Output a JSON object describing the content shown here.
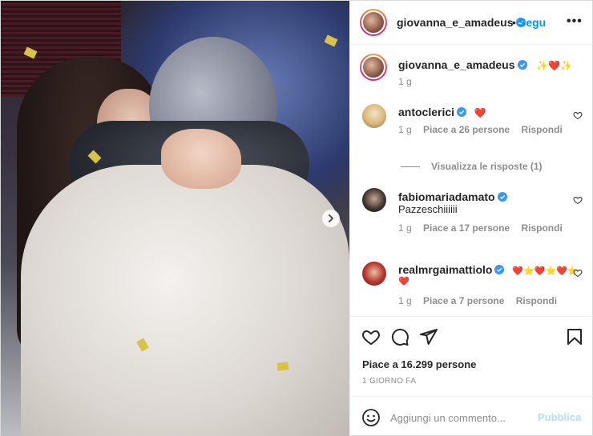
{
  "post": {
    "author": "giovanna_e_amadeus",
    "follow_label": "Segu",
    "more_label": "•••",
    "dot": "•"
  },
  "caption": {
    "username": "giovanna_e_amadeus",
    "text": "✨❤️✨",
    "time": "1 g"
  },
  "comments": [
    {
      "username": "antoclerici",
      "text": "❤️",
      "time": "1 g",
      "likes": "Piace a 26 persone",
      "reply": "Rispondi"
    },
    {
      "username": "fabiomariadamato",
      "text": "Pazzeschiiiiii",
      "time": "1 g",
      "likes": "Piace a 17 persone",
      "reply": "Rispondi"
    },
    {
      "username": "realmrgaimattiolo",
      "text": "❤️⭐❤️⭐❤️⭐",
      "text2": "❤️",
      "time": "1 g",
      "likes": "Piace a 7 persone",
      "reply": "Rispondi"
    }
  ],
  "view_replies": "Visualizza le risposte (1)",
  "footer": {
    "likes": "Piace a 16.299 persone",
    "ago": "1 GIORNO FA",
    "comment_placeholder": "Aggiungi un commento...",
    "publish_label": "Pubblica"
  },
  "colors": {
    "link": "#0095f6",
    "publish_disabled": "#b2dffc",
    "verified": "#3897f0",
    "muted": "#8e8e8e"
  },
  "icons": {
    "like": "heart-icon",
    "comment": "comment-icon",
    "share": "share-icon",
    "save": "bookmark-icon",
    "next": "chevron-right-icon",
    "emoji": "emoji-icon"
  }
}
